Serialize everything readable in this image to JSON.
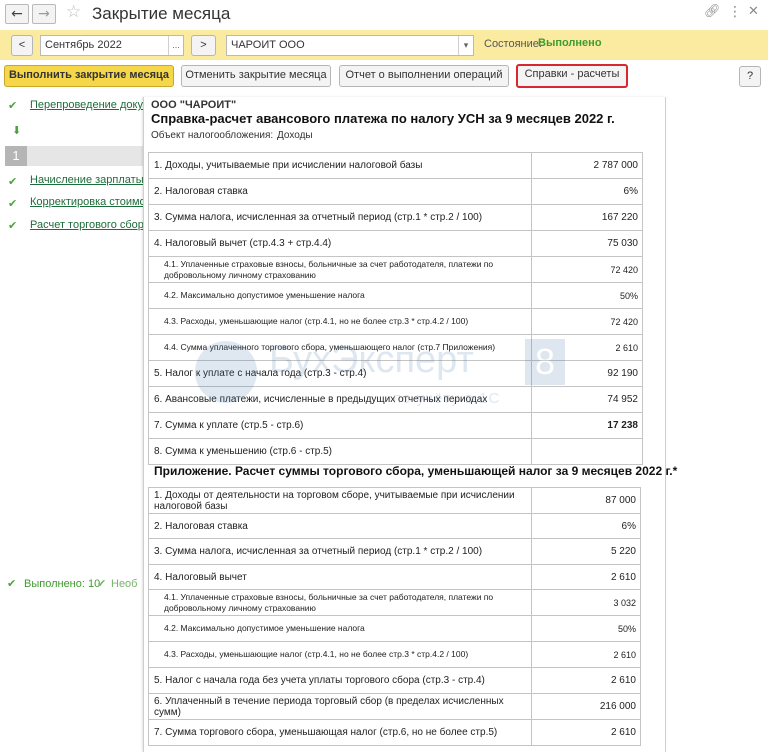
{
  "window": {
    "title": "Закрытие месяца",
    "icons": {
      "back": "arrow-left-icon",
      "forward": "arrow-right-icon",
      "favorite": "star-icon",
      "link": "link-icon",
      "more": "more-icon",
      "close": "close-icon"
    }
  },
  "period_bar": {
    "prev_label": "<",
    "period_value": "Сентябрь 2022",
    "choose_label": "...",
    "next_label": ">",
    "org_value": "ЧАРОИТ ООО",
    "status_label": "Состояние:",
    "status_value": "Выполнено",
    "accent": "#fbeba0",
    "status_color": "#3f9a2f"
  },
  "toolbar": {
    "run_label": "Выполнить закрытие месяца",
    "cancel_label": "Отменить закрытие месяца",
    "report_label": "Отчет о выполнении операций",
    "refs_label": "Справки - расчеты",
    "help_label": "?",
    "highlight_color": "#d9272e"
  },
  "operations": {
    "items": [
      {
        "label": "Перепроведение докуме"
      },
      {
        "label": "Начисление зарплаты"
      },
      {
        "label": "Корректировка стоимост"
      },
      {
        "label": "Расчет торгового сбора"
      }
    ],
    "stage_number": "1",
    "summary_ok": "Выполнено: 10",
    "summary_not": "Необ"
  },
  "report": {
    "org": "ООО \"ЧАРОИТ\"",
    "title": "Справка-расчет авансового платежа по налогу УСН за 9 месяцев 2022 г.",
    "object_label": "Объект налогообложения:",
    "object_value": "Доходы",
    "rows": [
      {
        "label": "1. Доходы, учитываемые при исчислении налоговой базы",
        "value": "2 787 000"
      },
      {
        "label": "2. Налоговая ставка",
        "value": "6%"
      },
      {
        "label": "3. Сумма налога, исчисленная за отчетный период (стр.1 * стр.2 / 100)",
        "value": "167 220"
      },
      {
        "label": "4. Налоговый вычет (стр.4.3 + стр.4.4)",
        "value": "75 030"
      },
      {
        "label": "4.1. Уплаченные страховые взносы, больничные за счет работодателя, платежи по добровольному личному страхованию",
        "value": "72 420"
      },
      {
        "label": "4.2. Максимально допустимое уменьшение налога",
        "value": "50%"
      },
      {
        "label": "4.3. Расходы, уменьшающие налог (стр.4.1, но не более стр.3 * стр.4.2 / 100)",
        "value": "72 420"
      },
      {
        "label": "4.4. Сумма уплаченного торгового сбора, уменьшающего налог (стр.7 Приложения)",
        "value": "2 610"
      },
      {
        "label": "5. Налог к уплате с начала года (стр.3 - стр.4)",
        "value": "92 190"
      },
      {
        "label": "6. Авансовые платежи, исчисленные в предыдущих отчетных периодах",
        "value": "74 952"
      },
      {
        "label": "7. Сумма к уплате (стр.5 - стр.6)",
        "value": "17 238"
      },
      {
        "label": "8. Сумма к уменьшению (стр.6 - стр.5)",
        "value": ""
      }
    ],
    "appendix_title": "Приложение. Расчет суммы торгового сбора, уменьшающей налог за 9 месяцев 2022 г.*",
    "appendix_rows": [
      {
        "label": "1. Доходы от деятельности на торговом сборе, учитываемые при исчислении налоговой базы",
        "value": "87 000"
      },
      {
        "label": "2. Налоговая ставка",
        "value": "6%"
      },
      {
        "label": "3. Сумма налога, исчисленная за отчетный период (стр.1 * стр.2 / 100)",
        "value": "5 220"
      },
      {
        "label": "4. Налоговый вычет",
        "value": "2 610"
      },
      {
        "label": "4.1. Уплаченные страховые взносы, больничные за счет работодателя, платежи по добровольному личному страхованию",
        "value": "3 032"
      },
      {
        "label": "4.2. Максимально допустимое уменьшение налога",
        "value": "50%"
      },
      {
        "label": "4.3. Расходы, уменьшающие налог (стр.4.1, но не более стр.3 * стр.4.2 / 100)",
        "value": "2 610"
      },
      {
        "label": "5. Налог с начала года без учета уплаты торгового сбора (стр.3 - стр.4)",
        "value": "2 610"
      },
      {
        "label": "6. Уплаченный в течение периода торговый сбор (в пределах исчисленных сумм)",
        "value": "216 000"
      },
      {
        "label": "7. Сумма торгового сбора, уменьшающая налог (стр.6, но не более стр.5)",
        "value": "2 610"
      }
    ]
  },
  "watermark": {
    "text": "БухЭксперт",
    "badge": "8",
    "subtitle": "по учёту в 1С",
    "logo": "buhexpert-logo"
  }
}
